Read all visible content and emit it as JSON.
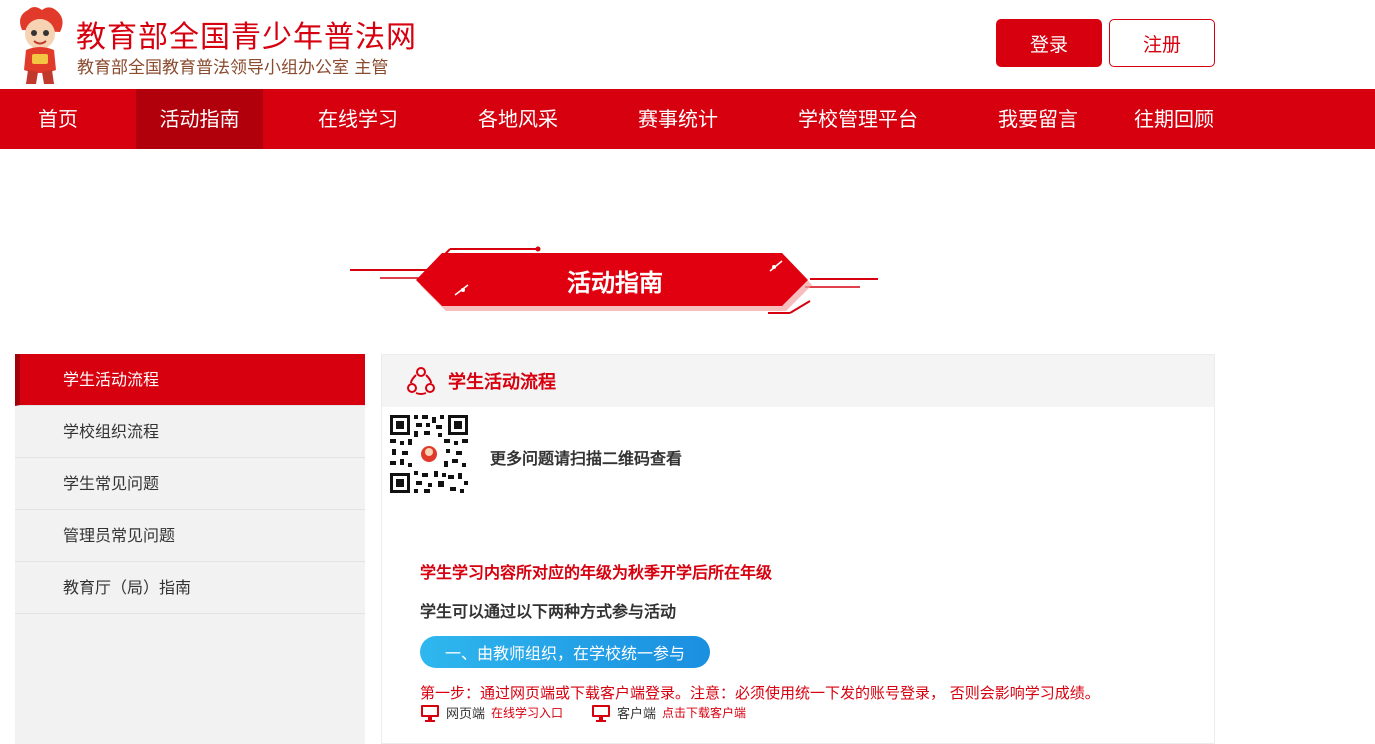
{
  "header": {
    "site_title": "教育部全国青少年普法网",
    "site_subtitle": "教育部全国教育普法领导小组办公室 主管",
    "login_label": "登录",
    "register_label": "注册"
  },
  "nav": {
    "items": [
      {
        "label": "首页"
      },
      {
        "label": "活动指南",
        "active": true
      },
      {
        "label": "在线学习"
      },
      {
        "label": "各地风采"
      },
      {
        "label": "赛事统计"
      },
      {
        "label": "学校管理平台"
      },
      {
        "label": "我要留言"
      },
      {
        "label": "往期回顾"
      }
    ]
  },
  "banner": {
    "title": "活动指南"
  },
  "sidebar": {
    "items": [
      {
        "label": "学生活动流程",
        "active": true
      },
      {
        "label": "学校组织流程"
      },
      {
        "label": "学生常见问题"
      },
      {
        "label": "管理员常见问题"
      },
      {
        "label": "教育厅（局）指南"
      }
    ]
  },
  "content": {
    "title": "学生活动流程",
    "qr_text": "更多问题请扫描二维码查看",
    "notice_red": "学生学习内容所对应的年级为秋季开学后所在年级",
    "notice_black": "学生可以通过以下两种方式参与活动",
    "method1": "一、由教师组织，在学校统一参与",
    "step1": "第一步：通过网页端或下载客户端登录。注意：必须使用统一下发的账号登录， 否则会影响学习成绩。",
    "web_label": "网页端",
    "web_link": "在线学习入口",
    "client_label": "客户端",
    "client_link": "点击下载客户端"
  },
  "colors": {
    "brand_red": "#d7000f",
    "nav_active": "#b1000c",
    "pill_blue": "#1a8fe0"
  }
}
